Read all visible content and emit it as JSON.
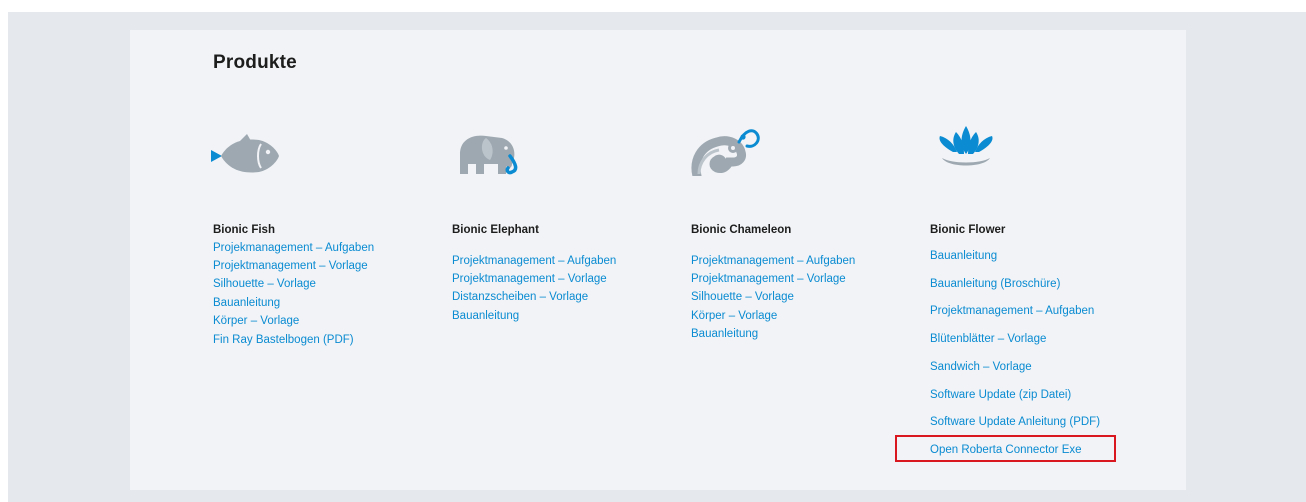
{
  "page": {
    "title": "Produkte"
  },
  "products": [
    {
      "name": "Bionic Fish",
      "icon": "fish-icon",
      "links": [
        "Projekmanagement – Aufgaben",
        "Projektmanagement – Vorlage",
        "Silhouette – Vorlage",
        "Bauanleitung",
        "Körper – Vorlage"
      ],
      "extra_link": "Fin Ray Bastelbogen (PDF)"
    },
    {
      "name": "Bionic Elephant",
      "icon": "elephant-icon",
      "links": [
        "Projektmanagement – Aufgaben",
        "Projektmanagement – Vorlage",
        "Distanzscheiben – Vorlage",
        "Bauanleitung"
      ]
    },
    {
      "name": "Bionic Chameleon",
      "icon": "chameleon-icon",
      "links": [
        "Projektmanagement – Aufgaben",
        "Projektmanagement – Vorlage",
        "Silhouette – Vorlage",
        "Körper – Vorlage",
        "Bauanleitung"
      ]
    },
    {
      "name": "Bionic Flower",
      "icon": "lotus-flower-icon",
      "links": [
        "Bauanleitung",
        "Bauanleitung (Broschüre)",
        "Projektmanagement – Aufgaben",
        "Blütenblätter – Vorlage",
        "Sandwich – Vorlage",
        "Software Update (zip Datei)",
        "Software Update Anleitung (PDF)",
        "Open Roberta Connector Exe"
      ]
    }
  ],
  "colors": {
    "link": "#0a8bd2",
    "icon_grey": "#9ea8b1",
    "icon_blue": "#0a8bd2",
    "highlight": "#d9171f",
    "panel": "#f1f3f6",
    "band": "#e5e8ec"
  }
}
